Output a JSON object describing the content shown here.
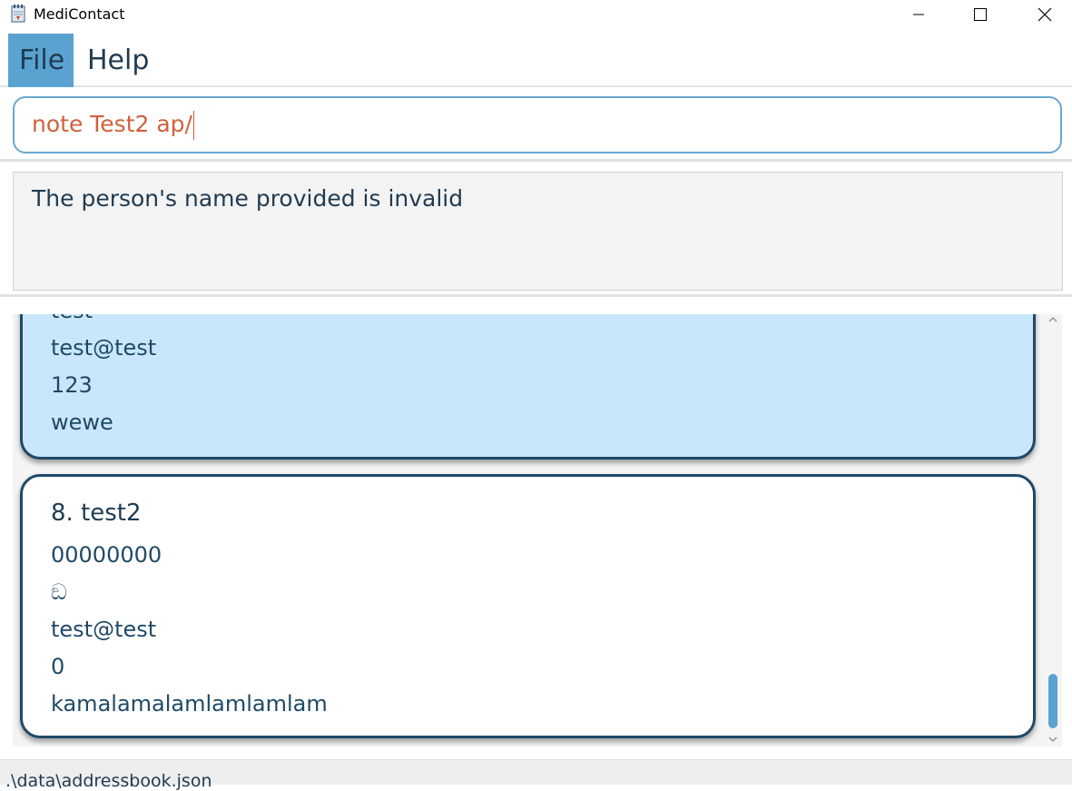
{
  "window": {
    "title": "MediContact",
    "icon": "notepad-icon"
  },
  "menu": {
    "file_label": "File",
    "help_label": "Help"
  },
  "command": {
    "value": "note Test2 ap/"
  },
  "result": {
    "message": "The person's name provided is invalid"
  },
  "persons": [
    {
      "selected": true,
      "lines": [
        "test",
        "test@test",
        "123",
        "wewe"
      ]
    },
    {
      "selected": false,
      "name": "8. test2",
      "lines": [
        "00000000",
        "ඞ",
        "test@test",
        "0",
        "kamalamalamlamlamlam"
      ]
    }
  ],
  "status": {
    "file_path": ".\\data\\addressbook.json"
  },
  "colors": {
    "accent": "#5aa3d1",
    "command_text": "#d0613e",
    "selected_card": "#c9e6fb",
    "card_border": "#1e4a68"
  }
}
